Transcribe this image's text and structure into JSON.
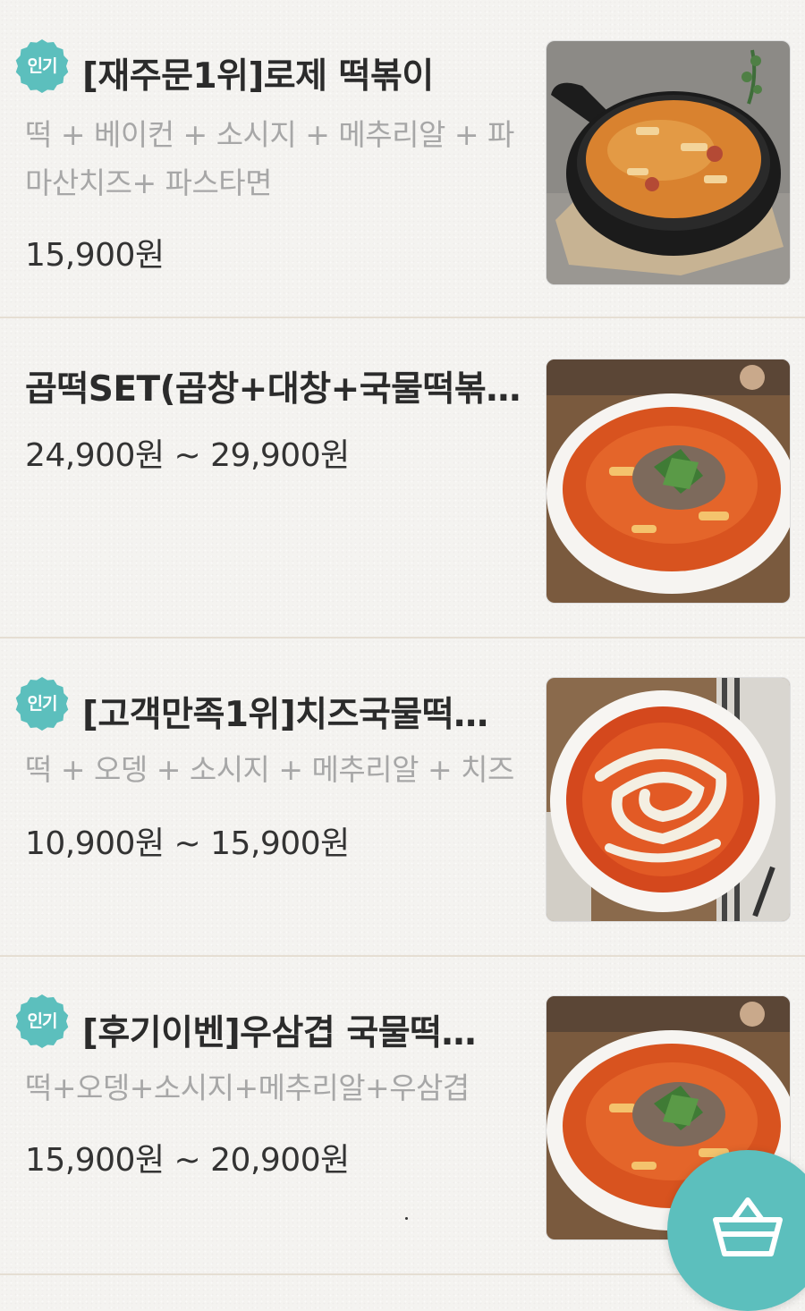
{
  "colors": {
    "accent": "#5cbfbd",
    "divider": "#e5ded3",
    "title": "#2b2b2b",
    "description": "#a7a7a7",
    "price": "#333333",
    "background": "#f4f3f0"
  },
  "menu": {
    "items": [
      {
        "badge": "인기",
        "name": "[재주문1위]로제 떡볶이",
        "description": "떡 + 베이컨 + 소시지 + 메추리알 + 파마산치즈+ 파스타면",
        "price": "15,900원",
        "image": "rose-tteokbokki-photo"
      },
      {
        "badge": "",
        "name": "곱떡SET(곱창+대창+국물떡볶…",
        "description": "",
        "price": "24,900원 ~ 29,900원",
        "image": "gobchang-tteokbokki-set-photo"
      },
      {
        "badge": "인기",
        "name": "[고객만족1위]치즈국물떡…",
        "description": "떡 + 오뎅 + 소시지 + 메추리알 + 치즈",
        "price": "10,900원 ~ 15,900원",
        "image": "cheese-soup-tteokbokki-photo"
      },
      {
        "badge": "인기",
        "name": "[후기이벤]우삼겹 국물떡…",
        "description": "떡+오뎅+소시지+메추리알+우삼겹",
        "price": "15,900원 ~ 20,900원",
        "image": "usamgyeop-soup-tteokbokki-photo"
      }
    ]
  },
  "cart": {
    "icon": "shopping-basket-icon"
  }
}
